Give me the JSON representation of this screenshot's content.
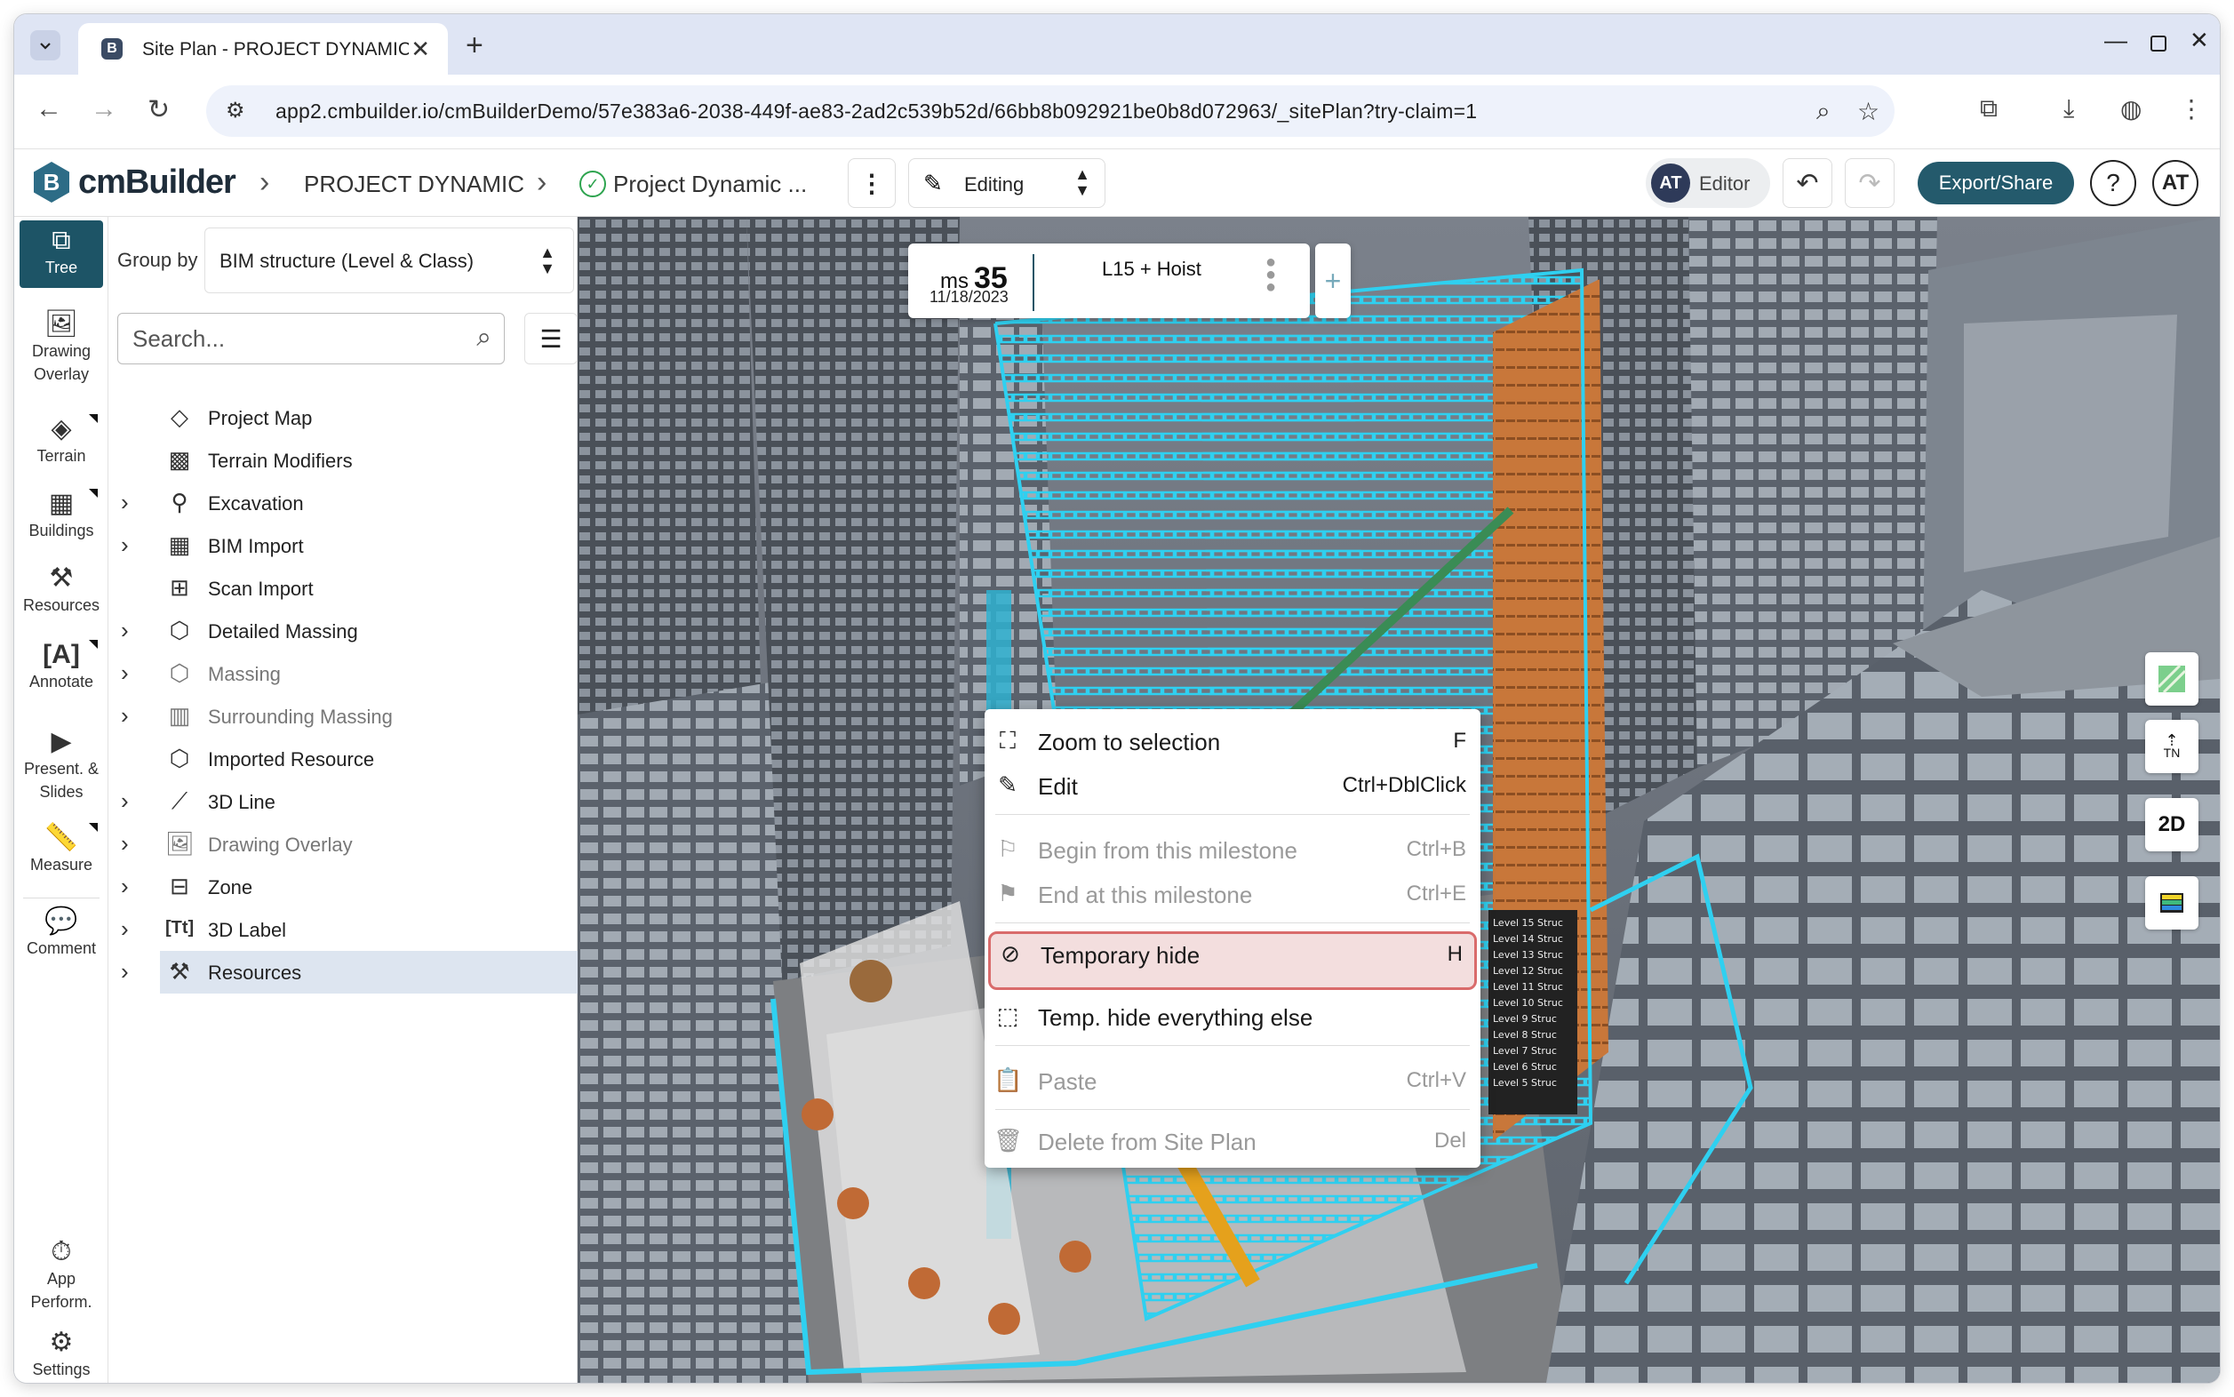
{
  "browser": {
    "tab_title": "Site Plan - PROJECT DYNAMIC |",
    "new_tab": "+",
    "url": "app2.cmbuilder.io/cmBuilderDemo/57e383a6-2038-449f-ae83-2ad2c539b52d/66bb8b092921be0b8d072963/_sitePlan?try-claim=1"
  },
  "header": {
    "logo_mark": "B",
    "logo": "cmBuilder",
    "breadcrumb_project": "PROJECT DYNAMIC",
    "breadcrumb_plan": "Project Dynamic ...",
    "mode": "Editing",
    "avatar_initials": "AT",
    "role": "Editor",
    "export_label": "Export/Share",
    "help": "?",
    "user_initials": "AT"
  },
  "rail": {
    "items": [
      {
        "label": "Tree",
        "icon": "tree-icon"
      },
      {
        "label": "Drawing Overlay",
        "icon": "drawing-overlay-icon"
      },
      {
        "label": "Terrain",
        "icon": "terrain-icon"
      },
      {
        "label": "Buildings",
        "icon": "buildings-icon"
      },
      {
        "label": "Resources",
        "icon": "resources-icon"
      },
      {
        "label": "Annotate",
        "icon": "annotate-icon"
      },
      {
        "label": "Present. & Slides",
        "icon": "presentation-icon"
      },
      {
        "label": "Measure",
        "icon": "ruler-icon"
      },
      {
        "label": "Comment",
        "icon": "comment-icon"
      },
      {
        "label": "App Perform.",
        "icon": "performance-icon"
      },
      {
        "label": "Settings",
        "icon": "gear-icon"
      }
    ]
  },
  "panel": {
    "group_by_label": "Group by",
    "group_by_value": "BIM structure (Level & Class)",
    "search_placeholder": "Search...",
    "tree": [
      {
        "label": "Project Map",
        "icon": "map-icon"
      },
      {
        "label": "Terrain Modifiers",
        "icon": "terrain-modifier-icon"
      },
      {
        "label": "Excavation",
        "icon": "excavation-icon"
      },
      {
        "label": "BIM Import",
        "icon": "bim-import-icon"
      },
      {
        "label": "Scan Import",
        "icon": "scan-import-icon"
      },
      {
        "label": "Detailed Massing",
        "icon": "detailed-massing-icon"
      },
      {
        "label": "Massing",
        "icon": "massing-icon"
      },
      {
        "label": "Surrounding Massing",
        "icon": "surrounding-massing-icon"
      },
      {
        "label": "Imported Resource",
        "icon": "imported-resource-icon"
      },
      {
        "label": "3D Line",
        "icon": "3d-line-icon"
      },
      {
        "label": "Drawing Overlay",
        "icon": "drawing-overlay-icon"
      },
      {
        "label": "Zone",
        "icon": "zone-icon"
      },
      {
        "label": "3D Label",
        "icon": "3d-label-icon"
      },
      {
        "label": "Resources",
        "icon": "resources-icon"
      }
    ]
  },
  "milestone": {
    "prefix": "ms",
    "number": "35",
    "date": "11/18/2023",
    "name": "L15 + Hoist",
    "add": "+"
  },
  "context_menu": {
    "items": [
      {
        "label": "Zoom to selection",
        "shortcut": "F",
        "icon": "zoom-selection-icon"
      },
      {
        "label": "Edit",
        "shortcut": "Ctrl+DblClick",
        "icon": "pencil-icon"
      },
      {
        "label": "Begin from this milestone",
        "shortcut": "Ctrl+B",
        "icon": "flag-icon"
      },
      {
        "label": "End at this milestone",
        "shortcut": "Ctrl+E",
        "icon": "finish-flag-icon"
      },
      {
        "label": "Temporary hide",
        "shortcut": "H",
        "icon": "hide-icon"
      },
      {
        "label": "Temp. hide everything else",
        "shortcut": "",
        "icon": "hide-others-icon"
      },
      {
        "label": "Paste",
        "shortcut": "Ctrl+V",
        "icon": "clipboard-icon"
      },
      {
        "label": "Delete from Site Plan",
        "shortcut": "Del",
        "icon": "trash-icon"
      }
    ]
  },
  "viewport": {
    "north": "TN",
    "view_mode": "2D",
    "scene_labels": [
      "Level 15 Struc",
      "Level 14 Struc",
      "Level 13 Struc",
      "Level 12 Struc",
      "Level 11 Struc",
      "Level 10 Struc",
      "Level 9 Struc",
      "Level 8 Struc",
      "Level 7 Struc",
      "Level 6 Struc",
      "Level 5 Struc"
    ]
  },
  "colors": {
    "accent": "#1d5466",
    "highlight_border": "#d96b6b",
    "bim_cyan": "#2fd0f0",
    "facade_orange": "#c8773a"
  }
}
